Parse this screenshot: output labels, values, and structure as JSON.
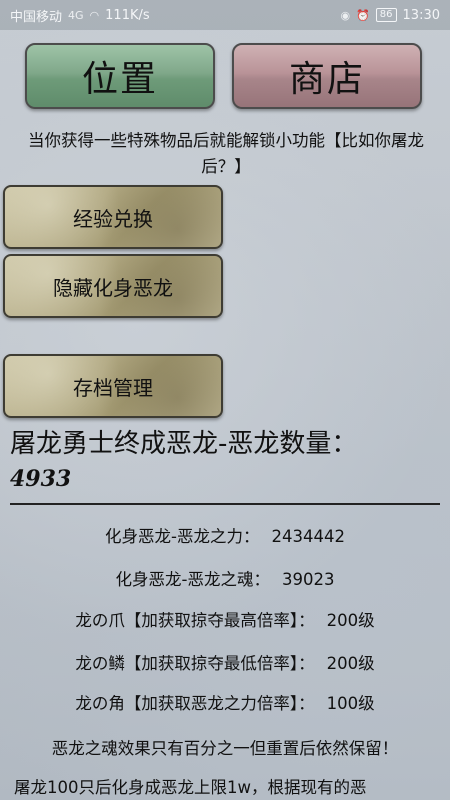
{
  "status_bar": {
    "carrier": "中国移动",
    "signal": "4G",
    "speed": "111K/s",
    "battery": "86",
    "time": "13:30"
  },
  "top_buttons": {
    "location": "位置",
    "shop": "商店"
  },
  "info": {
    "unlock_hint": "当你获得一些特殊物品后就能解锁小功能【比如你屠龙后？】"
  },
  "actions": {
    "exchange": "经验兑换",
    "transform": "隐藏化身恶龙",
    "save": "存档管理"
  },
  "dragon": {
    "title": "屠龙勇士终成恶龙-恶龙数量：",
    "count": "4933"
  },
  "stats": [
    {
      "label": "化身恶龙-恶龙之力：",
      "value": "2434442"
    },
    {
      "label": "化身恶龙-恶龙之魂：",
      "value": "39023"
    },
    {
      "label": "龙の爪【加获取掠夺最高倍率】：",
      "value": "200级"
    },
    {
      "label": "龙の鳞【加获取掠夺最低倍率】：",
      "value": "200级"
    },
    {
      "label": "龙の角【加获取恶龙之力倍率】：",
      "value": "100级"
    }
  ],
  "notes": {
    "soul_note": "恶龙之魂效果只有百分之一但重置后依然保留！",
    "limit_note": "屠龙100只后化身成恶龙上限1w，根据现有的恶"
  }
}
